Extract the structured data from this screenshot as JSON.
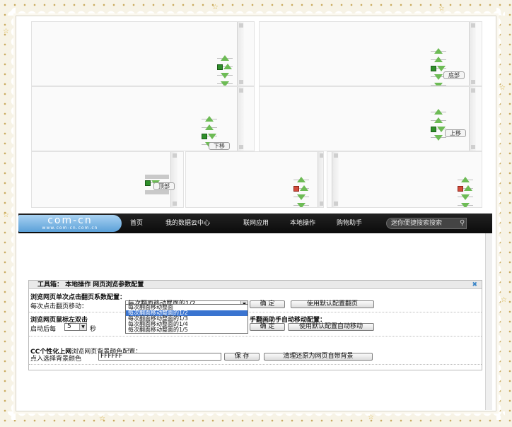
{
  "demo": {
    "tooltips": {
      "bottom": "底部",
      "down": "下移",
      "up": "上移",
      "top": "顶部"
    }
  },
  "site": {
    "logo": {
      "main": "com-cn",
      "sub": "www.com-cn.com.cn"
    },
    "nav": [
      "首页",
      "我的数据云中心",
      "联网应用",
      "本地操作",
      "购物助手"
    ],
    "search_placeholder": "迷你便捷搜索搜索"
  },
  "toolbox": {
    "header": "工具箱： 本地操作 网页浏览参数配置",
    "close": "✖",
    "section1": {
      "title": "浏览网页单次点击翻页系数配置：",
      "label": "每次点击翻页移动：",
      "selected": "每次翻面移动屏面的1/2",
      "confirm": "确 定",
      "default": "使用默认配置翻页",
      "options": [
        "每次翻面移动整面",
        "每次翻面移动整面的1/2",
        "每次翻面移动整面的1/3",
        "每次翻面移动整面的1/4",
        "每次翻面移动整面的1/5"
      ],
      "selected_index": 1
    },
    "section2": {
      "title_left": "浏览网页鼠标左双击",
      "title_right": "手翻画助手自动移动配置：",
      "label_prefix": "启动后每",
      "value": "5",
      "unit": "秒",
      "confirm": "确 定",
      "default": "使用默认配置自动移动"
    },
    "section3": {
      "title_bold": "CC个性化上网",
      "title_rest": "浏览网页背景颜色配置：",
      "label": "点入选择背景颜色",
      "value": "FFFFFF",
      "save": "保 存",
      "restore": "清理还原为网页自带背景"
    }
  },
  "colors": {
    "accent_green": "#6dbb55",
    "nav_bg": "#111111",
    "logo_blue": "#5ba0d8",
    "selection": "#3a74d0"
  }
}
